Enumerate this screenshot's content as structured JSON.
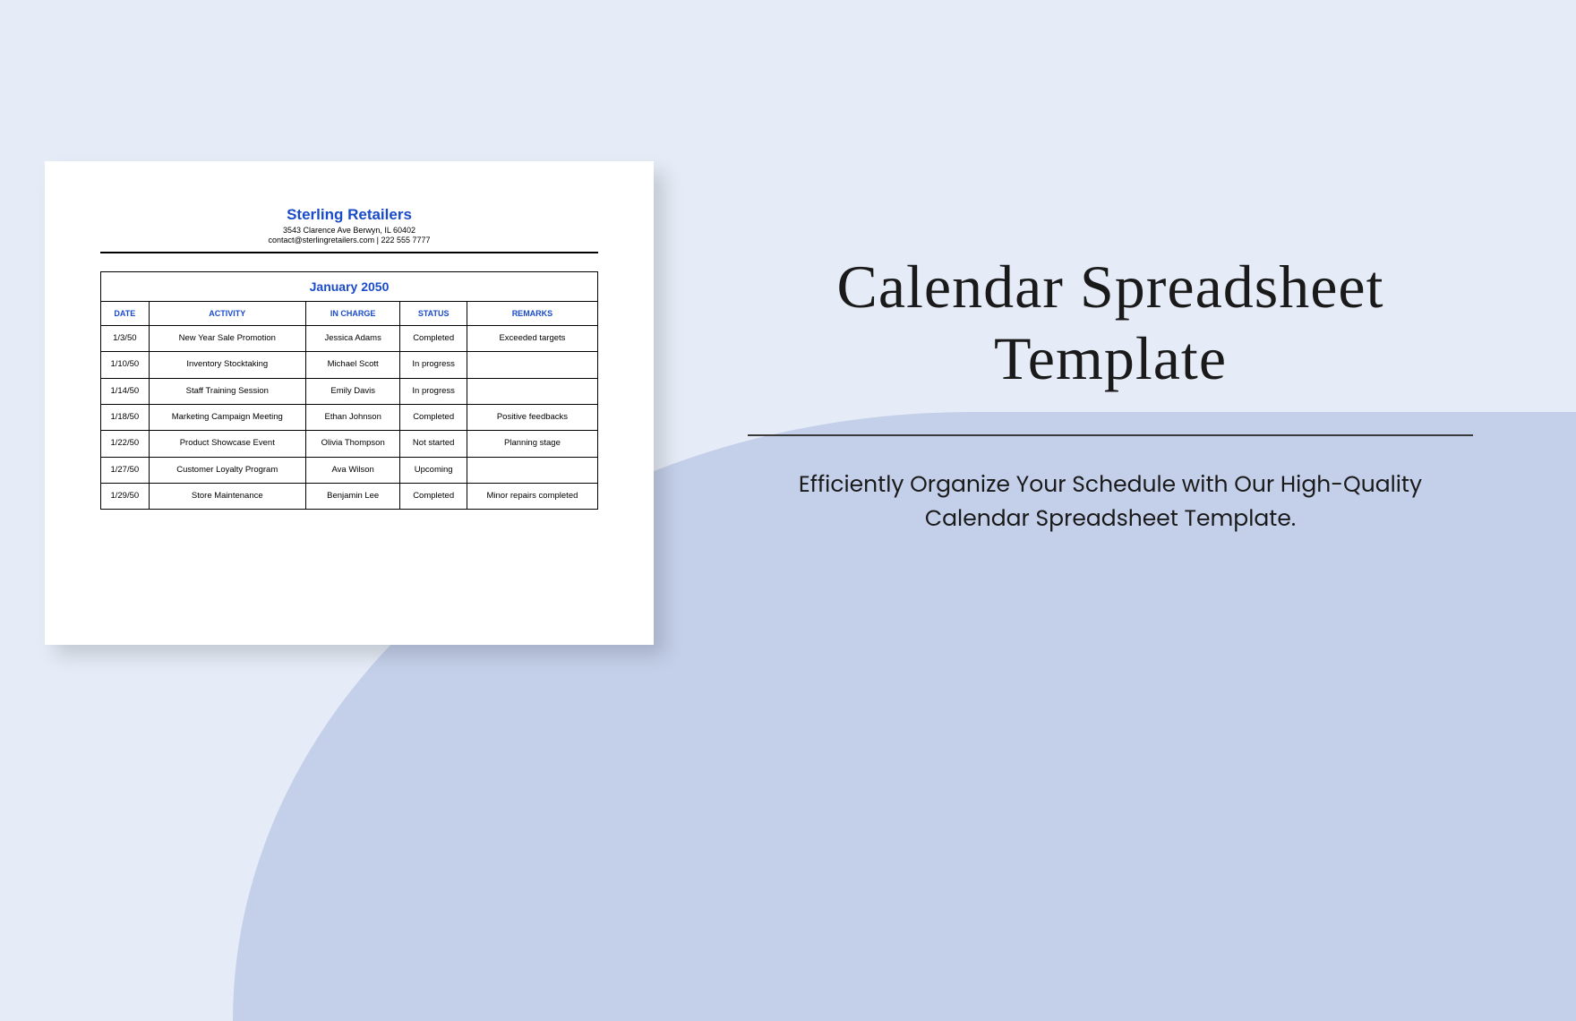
{
  "document": {
    "company_name": "Sterling Retailers",
    "address": "3543 Clarence Ave Berwyn, IL 60402",
    "contact": "contact@sterlingretailers.com | 222 555 7777",
    "month_title": "January 2050",
    "columns": {
      "date": "DATE",
      "activity": "ACTIVITY",
      "in_charge": "IN CHARGE",
      "status": "STATUS",
      "remarks": "REMARKS"
    },
    "rows": [
      {
        "date": "1/3/50",
        "activity": "New Year Sale Promotion",
        "in_charge": "Jessica Adams",
        "status": "Completed",
        "remarks": "Exceeded targets"
      },
      {
        "date": "1/10/50",
        "activity": "Inventory Stocktaking",
        "in_charge": "Michael Scott",
        "status": "In progress",
        "remarks": ""
      },
      {
        "date": "1/14/50",
        "activity": "Staff Training Session",
        "in_charge": "Emily Davis",
        "status": "In progress",
        "remarks": ""
      },
      {
        "date": "1/18/50",
        "activity": "Marketing Campaign Meeting",
        "in_charge": "Ethan Johnson",
        "status": "Completed",
        "remarks": "Positive feedbacks"
      },
      {
        "date": "1/22/50",
        "activity": "Product Showcase Event",
        "in_charge": "Olivia Thompson",
        "status": "Not started",
        "remarks": "Planning stage"
      },
      {
        "date": "1/27/50",
        "activity": "Customer Loyalty Program",
        "in_charge": "Ava Wilson",
        "status": "Upcoming",
        "remarks": ""
      },
      {
        "date": "1/29/50",
        "activity": "Store Maintenance",
        "in_charge": "Benjamin Lee",
        "status": "Completed",
        "remarks": "Minor repairs completed"
      }
    ]
  },
  "promo": {
    "title_line1": "Calendar Spreadsheet",
    "title_line2": "Template",
    "description": "Efficiently Organize Your Schedule with Our High-Quality Calendar Spreadsheet Template."
  }
}
